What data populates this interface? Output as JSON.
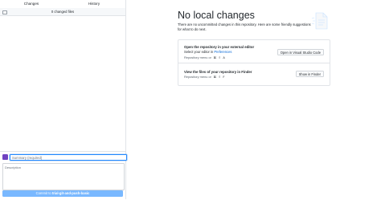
{
  "tabs": {
    "changes": "Changes",
    "history": "History"
  },
  "changes": {
    "count_label": "0 changed files"
  },
  "commit": {
    "summary_placeholder": "Summary (required)",
    "description_placeholder": "Description",
    "button_prefix": "Commit to ",
    "branch": "trial-git-and-push-basic"
  },
  "blank_slate": {
    "title": "No local changes",
    "subtitle": "There are no uncommitted changes in this repository. Here are some friendly suggestions for what to do next."
  },
  "suggestions": {
    "editor": {
      "title": "Open the repository in your external editor",
      "desc_prefix": "Select your editor in ",
      "desc_link": "Preferences",
      "menu_label": "Repository menu or",
      "shortcut_keys": [
        "⌘",
        "⇧",
        "A"
      ],
      "button": "Open in Visual Studio Code"
    },
    "finder": {
      "title": "View the files of your repository in Finder",
      "menu_label": "Repository menu or",
      "shortcut_keys": [
        "⌘",
        "⇧",
        "F"
      ],
      "button": "Show in Finder"
    }
  },
  "colors": {
    "accent": "#0366d6",
    "commit_button": "#79b8ff",
    "avatar": "#6f42c1"
  }
}
